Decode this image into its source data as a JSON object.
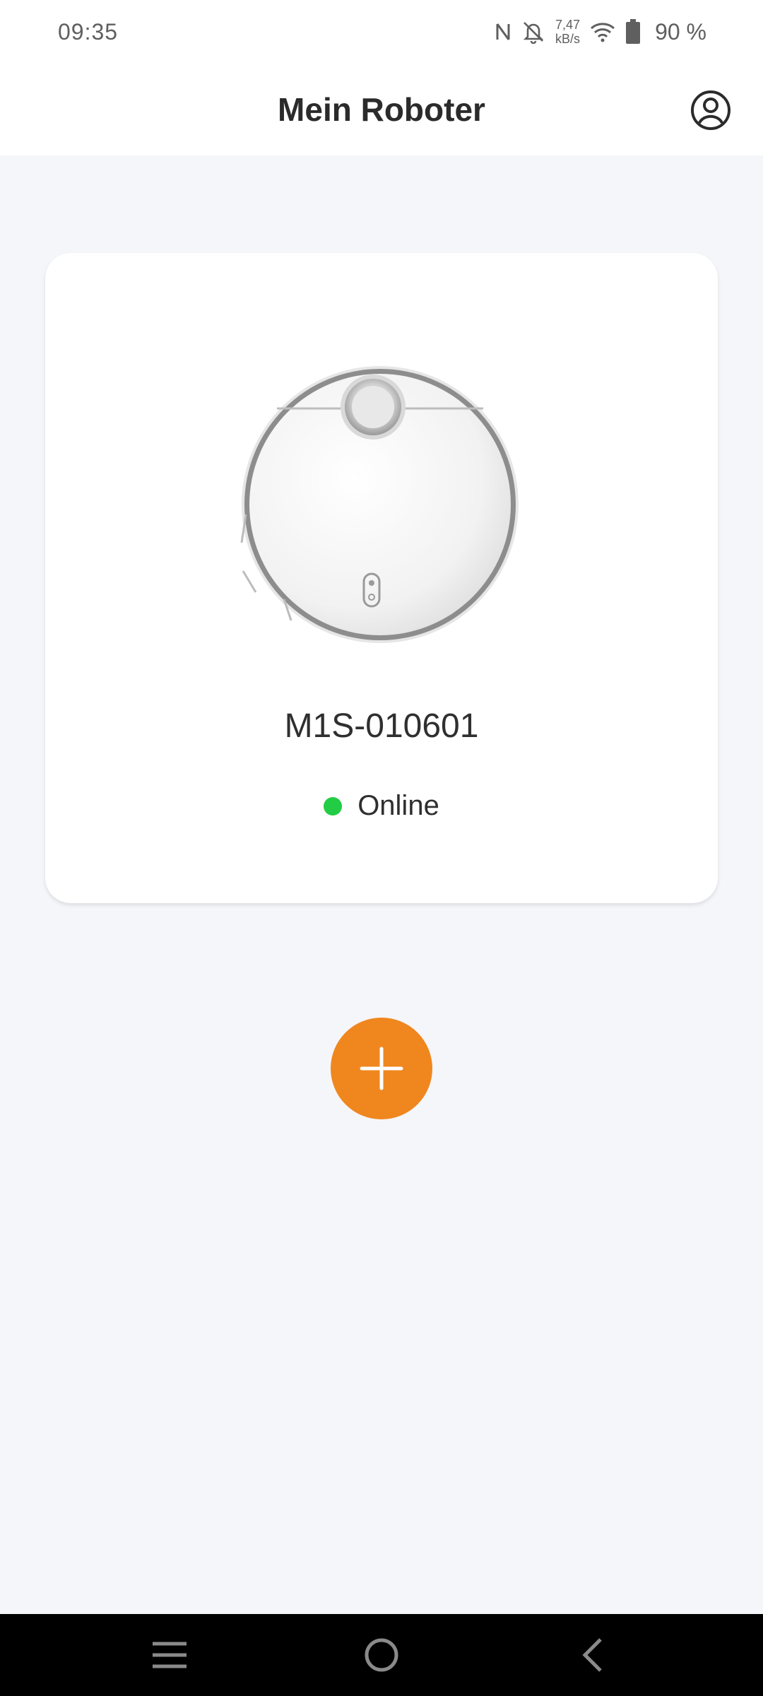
{
  "status_bar": {
    "time": "09:35",
    "net_speed_value": "7,47",
    "net_speed_unit": "kB/s",
    "battery": "90 %",
    "icons": [
      "nfc-icon",
      "bell-off-icon",
      "wifi-icon",
      "battery-icon"
    ]
  },
  "header": {
    "title": "Mein Roboter",
    "account_icon": "account-circle-icon"
  },
  "robot": {
    "name": "M1S-010601",
    "status": "Online",
    "status_color": "#22cc44",
    "image": "robot-vacuum-image"
  },
  "add_button": {
    "icon": "plus-icon",
    "color": "#f0861e"
  },
  "nav_bar": {
    "icons": [
      "menu-icon",
      "home-circle-icon",
      "back-chevron-icon"
    ]
  }
}
